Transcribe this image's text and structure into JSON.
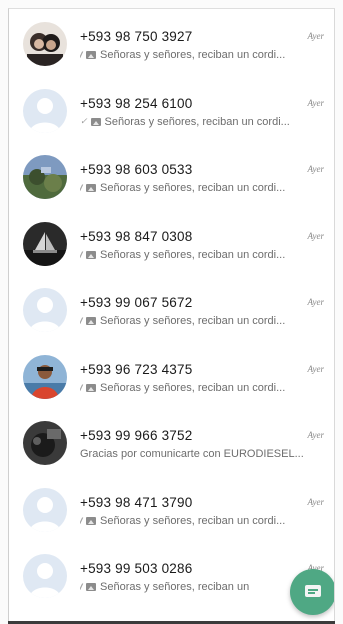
{
  "chats": [
    {
      "name": "+593 98 750 3927",
      "time": "Ayer",
      "ticks": "//",
      "has_image": true,
      "preview": "Señoras y señores, reciban un cordi...",
      "avatar": "photo-couple"
    },
    {
      "name": "+593 98 254 6100",
      "time": "Ayer",
      "ticks": "✓",
      "has_image": true,
      "preview": "Señoras y señores, reciban un cordi...",
      "avatar": "default"
    },
    {
      "name": "+593 98 603 0533",
      "time": "Ayer",
      "ticks": "//",
      "has_image": true,
      "preview": "Señoras y señores, reciban un cordi...",
      "avatar": "photo-landscape"
    },
    {
      "name": "+593 98 847 0308",
      "time": "Ayer",
      "ticks": "//",
      "has_image": true,
      "preview": "Señoras y señores, reciban un cordi...",
      "avatar": "photo-ship"
    },
    {
      "name": "+593 99 067 5672",
      "time": "Ayer",
      "ticks": "//",
      "has_image": true,
      "preview": "Señoras y señores, reciban un cordi...",
      "avatar": "default"
    },
    {
      "name": "+593 96 723 4375",
      "time": "Ayer",
      "ticks": "//",
      "has_image": true,
      "preview": "Señoras y señores, reciban un cordi...",
      "avatar": "photo-person"
    },
    {
      "name": "+593 99 966 3752",
      "time": "Ayer",
      "ticks": "",
      "has_image": false,
      "preview": "Gracias por comunicarte con EURODIESEL...",
      "avatar": "photo-dark"
    },
    {
      "name": "+593 98 471 3790",
      "time": "Ayer",
      "ticks": "//",
      "has_image": true,
      "preview": "Señoras y señores, reciban un cordi...",
      "avatar": "default"
    },
    {
      "name": "+593 99 503 0286",
      "time": "Ayer",
      "ticks": "//",
      "has_image": true,
      "preview": "Señoras y señores, reciban un",
      "avatar": "default"
    }
  ],
  "fab": {
    "icon": "chat-message-icon",
    "color": "#4fa884"
  },
  "colors": {
    "default_avatar_bg": "#dfe8f3",
    "default_avatar_fg": "#ffffff"
  }
}
